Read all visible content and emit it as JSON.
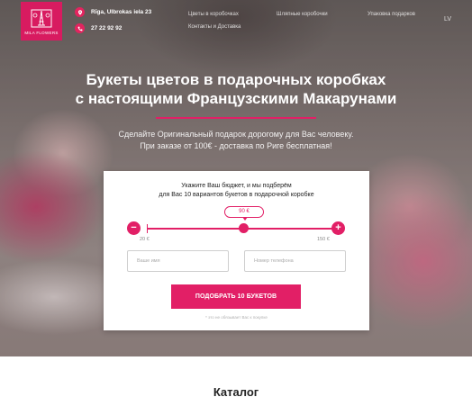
{
  "header": {
    "logo_text": "MILA FLOWERS",
    "address": "Rīga, Ulbrokas iela 23",
    "phone": "27 22 92 92",
    "nav": [
      "Цветы в коробочках",
      "Шляпные коробочки",
      "Упаковка подарков",
      "Контакты и Доставка"
    ],
    "language": "LV"
  },
  "hero": {
    "title_line1": "Букеты цветов в подарочных коробках",
    "title_line2": "с настоящими Французскими Макарунами",
    "subtitle_line1": "Сделайте Оригинальный подарок дорогому для Вас человеку.",
    "subtitle_line2": "При заказе от 100€ - доставка по Риге бесплатная!"
  },
  "form": {
    "title_line1": "Укажите Ваш бюджет, и мы подберём",
    "title_line2": "для Вас 10 вариантов букетов в подарочной коробке",
    "budget": {
      "value_label": "90 €",
      "min_label": "20 €",
      "max_label": "150 €",
      "min": 20,
      "max": 150,
      "value": 90
    },
    "minus_label": "−",
    "plus_label": "+",
    "name_placeholder": "Ваше имя",
    "phone_placeholder": "Номер телефона",
    "submit_label": "ПОДОБРАТЬ 10 БУКЕТОВ",
    "note": "* это не обязывает Вас к покупке"
  },
  "catalog": {
    "heading": "Каталог"
  },
  "colors": {
    "accent": "#e21f66",
    "logo_bg": "#d81b60"
  },
  "icons": [
    "map-pin-icon",
    "phone-icon",
    "eiffel-tower-icon"
  ]
}
